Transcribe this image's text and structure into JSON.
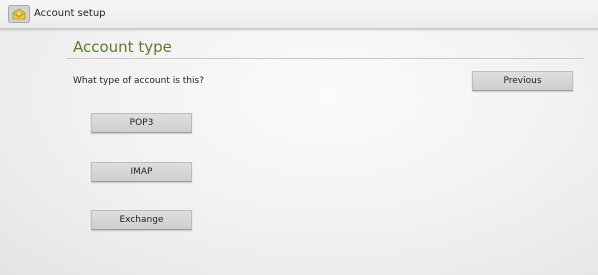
{
  "action_bar": {
    "title": "Account setup",
    "app_icon": "email-envelope-icon"
  },
  "page": {
    "title": "Account type",
    "question": "What type of account is this?"
  },
  "buttons": {
    "previous": "Previous",
    "pop3": "POP3",
    "imap": "IMAP",
    "exchange": "Exchange"
  },
  "colors": {
    "title_accent": "#5b7e2a",
    "icon_yellow": "#e8c633"
  }
}
